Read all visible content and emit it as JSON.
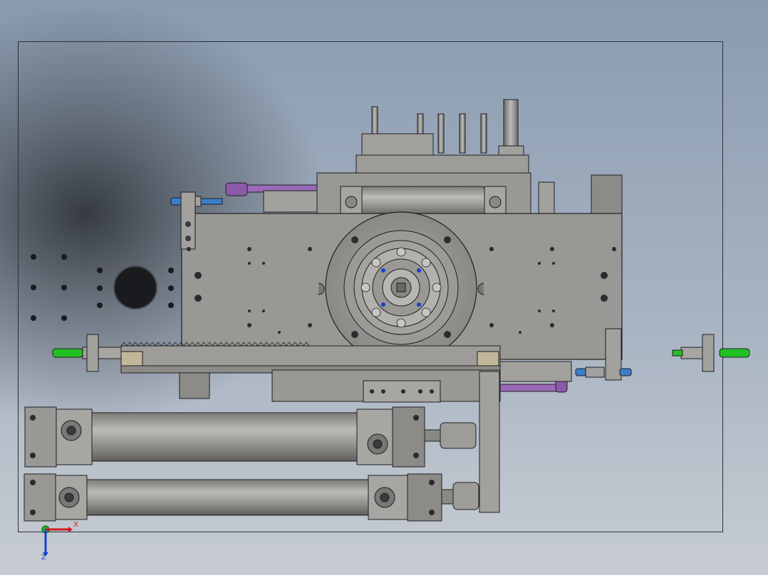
{
  "viewport": {
    "background_top": "#8a9bb0",
    "background_bottom": "#c7ccd3"
  },
  "model": {
    "part_color": "#9a9894",
    "edge_color": "#1e1f22",
    "accent_green": "#22c022",
    "accent_blue": "#3a7fc8",
    "accent_purple": "#8a5aa8"
  },
  "triad": {
    "x_label": "X",
    "z_label": "Z",
    "x_color": "#d01818",
    "y_color": "#22b022",
    "z_color": "#1a3fd0"
  }
}
